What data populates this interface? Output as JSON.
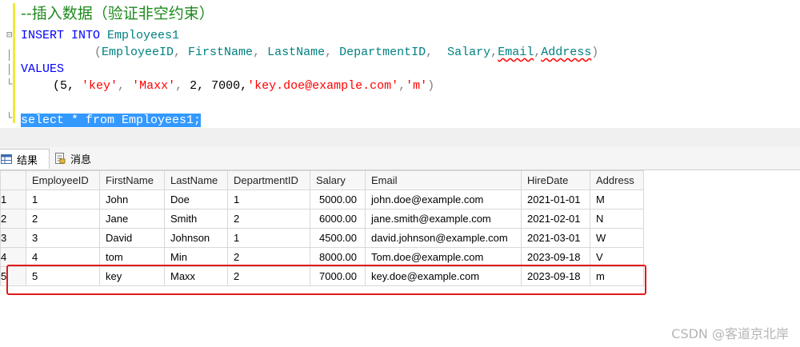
{
  "editor": {
    "comment": "--插入数据（验证非空约束）",
    "insert_kw": "INSERT INTO",
    "table_name": "Employees1",
    "columns_open": "(",
    "col1": "EmployeeID",
    "col2": "FirstName",
    "col3": "LastName",
    "col4": "DepartmentID",
    "col5": "Salary",
    "col6": "Email",
    "col7": "Address",
    "columns_close": ")",
    "values_kw": "VALUES",
    "v_open": "(5,",
    "v_first": "'key'",
    "v_last": "'Maxx'",
    "v_nums": "2, 7000,",
    "v_email": "'key.doe@example.com'",
    "v_addr": "'m'",
    "v_close": ")",
    "select_stmt": "select * from Employees1;"
  },
  "tabs": {
    "results": "结果",
    "messages": "消息"
  },
  "grid": {
    "columns": [
      "EmployeeID",
      "FirstName",
      "LastName",
      "DepartmentID",
      "Salary",
      "Email",
      "HireDate",
      "Address"
    ],
    "rows": [
      {
        "rownum": "1",
        "cells": [
          "1",
          "John",
          "Doe",
          "1",
          "5000.00",
          "john.doe@example.com",
          "2021-01-01",
          "M"
        ]
      },
      {
        "rownum": "2",
        "cells": [
          "2",
          "Jane",
          "Smith",
          "2",
          "6000.00",
          "jane.smith@example.com",
          "2021-02-01",
          "N"
        ]
      },
      {
        "rownum": "3",
        "cells": [
          "3",
          "David",
          "Johnson",
          "1",
          "4500.00",
          "david.johnson@example.com",
          "2021-03-01",
          "W"
        ]
      },
      {
        "rownum": "4",
        "cells": [
          "4",
          "tom",
          "Min",
          "2",
          "8000.00",
          "Tom.doe@example.com",
          "2023-09-18",
          "V"
        ]
      },
      {
        "rownum": "5",
        "cells": [
          "5",
          "key",
          "Maxx",
          "2",
          "7000.00",
          "key.doe@example.com",
          "2023-09-18",
          "m"
        ]
      }
    ]
  },
  "watermark": "CSDN @客道京北岸",
  "colors": {
    "highlight_box": "#e21a1a",
    "selection": "#3399ff",
    "keyword": "#0000ff",
    "string": "#ff0000",
    "comment": "#1e8a1e"
  }
}
